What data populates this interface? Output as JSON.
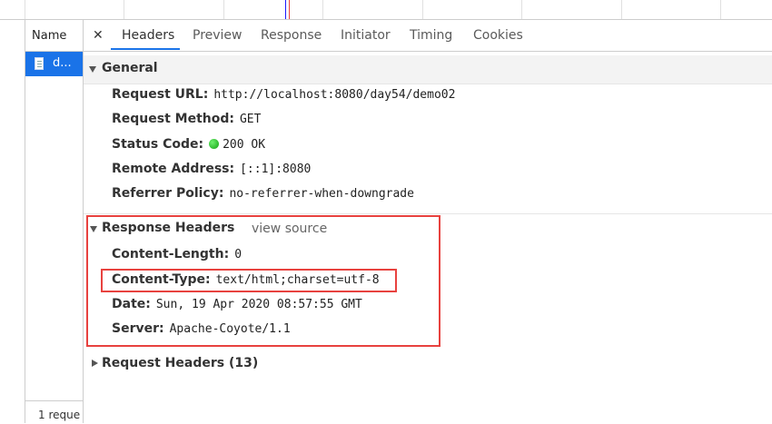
{
  "name_column": {
    "header": "Name",
    "selected_item": "d...",
    "footer": "1 reque"
  },
  "tabs": [
    {
      "label": "Headers",
      "active": true
    },
    {
      "label": "Preview",
      "active": false
    },
    {
      "label": "Response",
      "active": false
    },
    {
      "label": "Initiator",
      "active": false
    },
    {
      "label": "Timing",
      "active": false
    },
    {
      "label": "Cookies",
      "active": false
    }
  ],
  "close_glyph": "✕",
  "general": {
    "title": "General",
    "rows": [
      {
        "key": "Request URL:",
        "value": "http://localhost:8080/day54/demo02"
      },
      {
        "key": "Request Method:",
        "value": "GET"
      },
      {
        "key": "Status Code:",
        "value": "200 OK",
        "status_color": "#12a012"
      },
      {
        "key": "Remote Address:",
        "value": "[::1]:8080"
      },
      {
        "key": "Referrer Policy:",
        "value": "no-referrer-when-downgrade"
      }
    ]
  },
  "response_headers": {
    "title": "Response Headers",
    "view_source": "view source",
    "rows": [
      {
        "key": "Content-Length:",
        "value": "0"
      },
      {
        "key": "Content-Type:",
        "value": "text/html;charset=utf-8"
      },
      {
        "key": "Date:",
        "value": "Sun, 19 Apr 2020 08:57:55 GMT"
      },
      {
        "key": "Server:",
        "value": "Apache-Coyote/1.1"
      }
    ]
  },
  "request_headers": {
    "title": "Request Headers (13)"
  },
  "colors": {
    "accent": "#1a73e8",
    "highlight_box": "#e8423f"
  }
}
